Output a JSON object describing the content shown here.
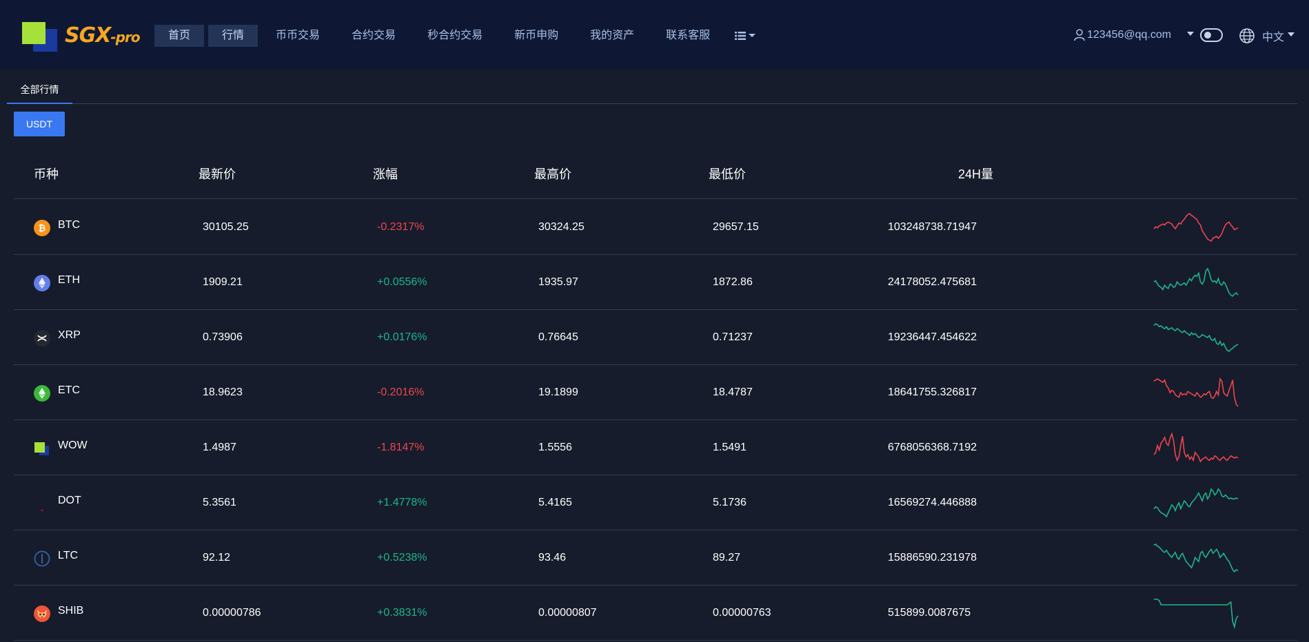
{
  "brand": {
    "name": "SGX",
    "suffix": "-pro"
  },
  "nav": {
    "items": [
      {
        "label": "首页",
        "boxed": true
      },
      {
        "label": "行情",
        "boxed": true
      },
      {
        "label": "币币交易",
        "boxed": false
      },
      {
        "label": "合约交易",
        "boxed": false
      },
      {
        "label": "秒合约交易",
        "boxed": false
      },
      {
        "label": "新币申购",
        "boxed": false
      },
      {
        "label": "我的资产",
        "boxed": false
      },
      {
        "label": "联系客服",
        "boxed": false
      }
    ],
    "more_icon": "list-icon"
  },
  "user": {
    "email": "123456@qq.com",
    "icon": "user-icon"
  },
  "language": {
    "label": "中文",
    "icon": "globe-icon"
  },
  "tabs": [
    {
      "label": "全部行情",
      "active": true
    }
  ],
  "filter": {
    "label": "USDT"
  },
  "table": {
    "headers": [
      "币种",
      "最新价",
      "涨幅",
      "最高价",
      "最低价",
      "24H量"
    ],
    "rows": [
      {
        "coin": "BTC",
        "price": "30105.25",
        "change": "-0.2317%",
        "high": "30324.25",
        "low": "29657.15",
        "volume": "103248738.71947",
        "trend": "down",
        "icon": "bitcoin-icon",
        "icon_color": "#f7931a",
        "spark": [
          20,
          22,
          21,
          23,
          24,
          25,
          24,
          26,
          27,
          26,
          25,
          22,
          20,
          23,
          26,
          25,
          28,
          30,
          33,
          35,
          36,
          34,
          33,
          31,
          30,
          26,
          24,
          18,
          15,
          12,
          9,
          8,
          7,
          10,
          11,
          12,
          10,
          12,
          15,
          20,
          24,
          26,
          27,
          24,
          22,
          19,
          20,
          21
        ]
      },
      {
        "coin": "ETH",
        "price": "1909.21",
        "change": "+0.0556%",
        "high": "1935.97",
        "low": "1872.86",
        "volume": "24178052.475681",
        "trend": "up",
        "icon": "ethereum-icon",
        "icon_color": "#627eea",
        "spark": [
          30,
          31,
          28,
          26,
          25,
          23,
          27,
          25,
          24,
          28,
          27,
          25,
          26,
          30,
          28,
          27,
          28,
          29,
          27,
          30,
          33,
          31,
          34,
          36,
          35,
          38,
          30,
          28,
          31,
          40,
          42,
          38,
          32,
          30,
          31,
          29,
          33,
          28,
          27,
          30,
          28,
          24,
          20,
          18,
          17,
          19,
          20,
          18
        ]
      },
      {
        "coin": "XRP",
        "price": "0.73906",
        "change": "+0.0176%",
        "high": "0.76645",
        "low": "0.71237",
        "volume": "19236447.454622",
        "trend": "up",
        "icon": "xrp-icon",
        "icon_color": "#23292f",
        "spark": [
          40,
          42,
          41,
          39,
          40,
          38,
          37,
          39,
          36,
          37,
          38,
          36,
          35,
          37,
          36,
          34,
          33,
          35,
          33,
          32,
          30,
          33,
          31,
          32,
          30,
          28,
          29,
          31,
          30,
          29,
          28,
          30,
          26,
          25,
          27,
          22,
          21,
          24,
          20,
          22,
          18,
          15,
          14,
          16,
          17,
          19,
          20,
          21
        ]
      },
      {
        "coin": "ETC",
        "price": "18.9623",
        "change": "-0.2016%",
        "high": "19.1899",
        "low": "18.4787",
        "volume": "18641755.326817",
        "trend": "down",
        "icon": "ethereum-classic-icon",
        "icon_color": "#3ab83a",
        "spark": [
          34,
          35,
          36,
          35,
          34,
          33,
          35,
          30,
          28,
          24,
          26,
          25,
          22,
          21,
          20,
          24,
          22,
          23,
          22,
          25,
          24,
          23,
          22,
          21,
          24,
          22,
          20,
          21,
          23,
          22,
          24,
          25,
          20,
          19,
          21,
          25,
          22,
          36,
          34,
          24,
          22,
          21,
          26,
          30,
          35,
          20,
          14,
          12
        ]
      },
      {
        "coin": "WOW",
        "price": "1.4987",
        "change": "-1.8147%",
        "high": "1.5556",
        "low": "1.5491",
        "volume": "6768056368.7192",
        "trend": "down",
        "icon": "wow-logo-icon",
        "icon_color": "#a6e03a",
        "spark": [
          20,
          22,
          28,
          24,
          30,
          32,
          35,
          30,
          28,
          34,
          38,
          32,
          20,
          15,
          18,
          28,
          36,
          22,
          18,
          20,
          16,
          18,
          15,
          22,
          20,
          18,
          14,
          16,
          17,
          18,
          16,
          15,
          17,
          16,
          19,
          18,
          16,
          15,
          17,
          18,
          16,
          15,
          17,
          19,
          18,
          17,
          18,
          17
        ]
      },
      {
        "coin": "DOT",
        "price": "5.3561",
        "change": "+1.4778%",
        "high": "5.4165",
        "low": "5.1736",
        "volume": "16569274.446888",
        "trend": "up",
        "icon": "polkadot-icon",
        "icon_color": "#e6007a",
        "spark": [
          22,
          24,
          23,
          20,
          18,
          17,
          16,
          14,
          18,
          22,
          26,
          24,
          20,
          25,
          28,
          22,
          26,
          30,
          28,
          25,
          24,
          28,
          30,
          32,
          35,
          38,
          34,
          30,
          36,
          38,
          32,
          35,
          42,
          40,
          36,
          38,
          42,
          40,
          35,
          34,
          36,
          34,
          32,
          33,
          32,
          32,
          33,
          32
        ]
      },
      {
        "coin": "LTC",
        "price": "92.12",
        "change": "+0.5238%",
        "high": "93.46",
        "low": "89.27",
        "volume": "15886590.231978",
        "trend": "up",
        "icon": "litecoin-icon",
        "icon_color": "#345d9d",
        "spark": [
          42,
          43,
          41,
          40,
          38,
          36,
          35,
          37,
          34,
          32,
          30,
          33,
          35,
          30,
          28,
          32,
          34,
          30,
          26,
          24,
          22,
          20,
          24,
          30,
          28,
          26,
          34,
          36,
          32,
          30,
          33,
          36,
          38,
          34,
          36,
          38,
          35,
          30,
          32,
          34,
          31,
          28,
          26,
          22,
          18,
          16,
          18,
          17
        ]
      },
      {
        "coin": "SHIB",
        "price": "0.00000786",
        "change": "+0.3831%",
        "high": "0.00000807",
        "low": "0.00000763",
        "volume": "515899.0087675",
        "trend": "up",
        "icon": "shiba-inu-icon",
        "icon_color": "#f0543b",
        "spark": [
          44,
          44,
          44,
          43,
          40,
          40,
          40,
          40,
          40,
          40,
          40,
          40,
          40,
          40,
          40,
          40,
          40,
          40,
          40,
          40,
          40,
          40,
          40,
          40,
          40,
          40,
          40,
          40,
          40,
          40,
          40,
          40,
          40,
          40,
          40,
          40,
          40,
          40,
          40,
          40,
          40,
          40,
          41,
          42,
          28,
          24,
          30,
          32
        ]
      }
    ]
  },
  "colors": {
    "up": "#1fb58c",
    "down": "#f0444f",
    "accent": "#3a78f2",
    "topbar": "#0e1834",
    "background": "#161c2b"
  }
}
